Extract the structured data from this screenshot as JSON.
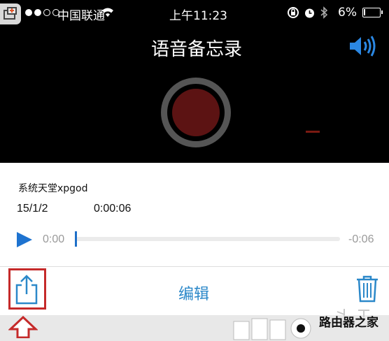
{
  "status_bar": {
    "carrier": "中国联通",
    "time": "上午11:23",
    "battery_percent": "6%",
    "battery_level": 0.06,
    "signal_bars_filled": 2,
    "signal_bars_total": 4
  },
  "header": {
    "title": "语音备忘录"
  },
  "recording": {
    "name": "系统天堂xpgod",
    "date": "15/1/2",
    "duration": "0:00:06"
  },
  "playback": {
    "current_time": "0:00",
    "remaining_time": "-0:06",
    "progress": 0.0
  },
  "toolbar": {
    "edit_label": "编辑"
  },
  "watermark": {
    "text": "路由器之家"
  },
  "icons": {
    "corner_badge": "screen-corner-icon",
    "wifi": "wifi-icon",
    "rotation_lock": "rotation-lock-icon",
    "alarm": "alarm-clock-icon",
    "bluetooth": "bluetooth-icon",
    "speaker": "speaker-icon",
    "record": "record-icon",
    "play": "play-icon",
    "share": "share-icon",
    "trash": "trash-icon",
    "arrow": "arrow-up-icon"
  },
  "colors": {
    "accent": "#2b88c9",
    "record_core": "#5c1313",
    "highlight": "#c52a2a",
    "background_top": "#000000"
  }
}
